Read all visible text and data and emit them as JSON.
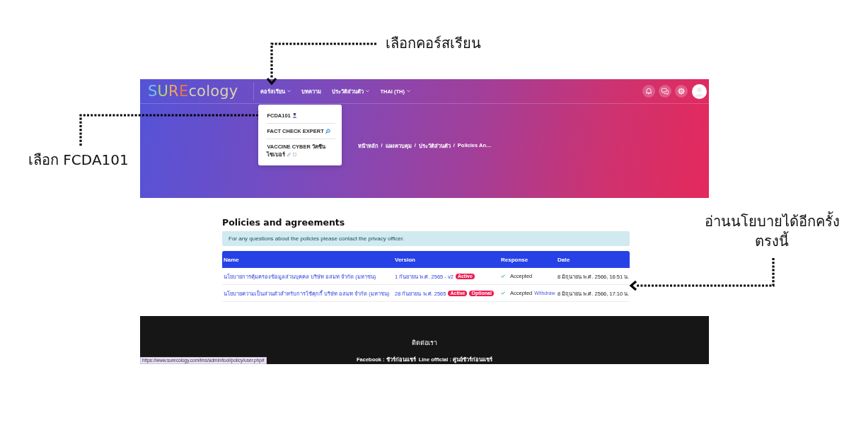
{
  "header": {
    "logo": {
      "highlight": "SURE",
      "rest": "cology"
    },
    "nav": [
      {
        "label": "คอร์สเรียน",
        "dropdown": true,
        "menu": [
          {
            "label": "FCDA101",
            "kind": "student"
          },
          {
            "label": "FACT CHECK EXPERT",
            "kind": "search"
          },
          {
            "label": "VACCINE CYBER วัคซีน ไซเบอร์",
            "kind": "vaccine"
          }
        ]
      },
      {
        "label": "บทความ",
        "dropdown": false
      },
      {
        "label": "ประวัติส่วนตัว",
        "dropdown": true
      },
      {
        "label": "THAI (TH)",
        "dropdown": true
      }
    ],
    "breadcrumb": {
      "separator": "/",
      "items": [
        "หน้าหลัก",
        "แผงควบคุม",
        "ประวัติส่วนตัว",
        "Policies An…"
      ]
    }
  },
  "page": {
    "title": "Policies and agreements",
    "notice": "For any questions about the policies please contact the privacy officer.",
    "table": {
      "columns": [
        "Name",
        "Version",
        "Response",
        "Date"
      ],
      "rows": [
        {
          "name": "นโยบายการคุ้มครองข้อมูลส่วนบุคคล บริษัท อสมท จำกัด (มหาชน)",
          "version": "1 กันยายน พ.ศ. 2565 - v2",
          "badges": [
            "Active"
          ],
          "accepted": true,
          "response": "Accepted",
          "date": "8 มิถุนายน พ.ศ. 2566, 16:51 น."
        },
        {
          "name": "นโยบายความเป็นส่วนตัวสำหรับการใช้คุกกี้ บริษัท อสมท จำกัด (มหาชน)",
          "version": "28 กันยายน พ.ศ. 2565",
          "badges": [
            "Active",
            "Optional"
          ],
          "accepted": true,
          "response": "Accepted",
          "withdraw": "Withdraw",
          "date": "8 มิถุนายน พ.ศ. 2566, 17:10 น."
        }
      ]
    }
  },
  "footer": {
    "heading": "ติดต่อเรา",
    "contacts": [
      "Facebook : ชัวร์ก่อนแชร์",
      "Line official : ศูนย์ชัวร์ก่อนแชร์"
    ]
  },
  "status_url": "https://www.surecology.com/lms/admin/tool/policy/user.php#",
  "annotations": [
    {
      "text": "เลือกคอร์สเรียน"
    },
    {
      "text": "เลือก FCDA101"
    },
    {
      "text": "อ่านนโยบายได้อีกครั้ง ตรงนี้"
    }
  ]
}
